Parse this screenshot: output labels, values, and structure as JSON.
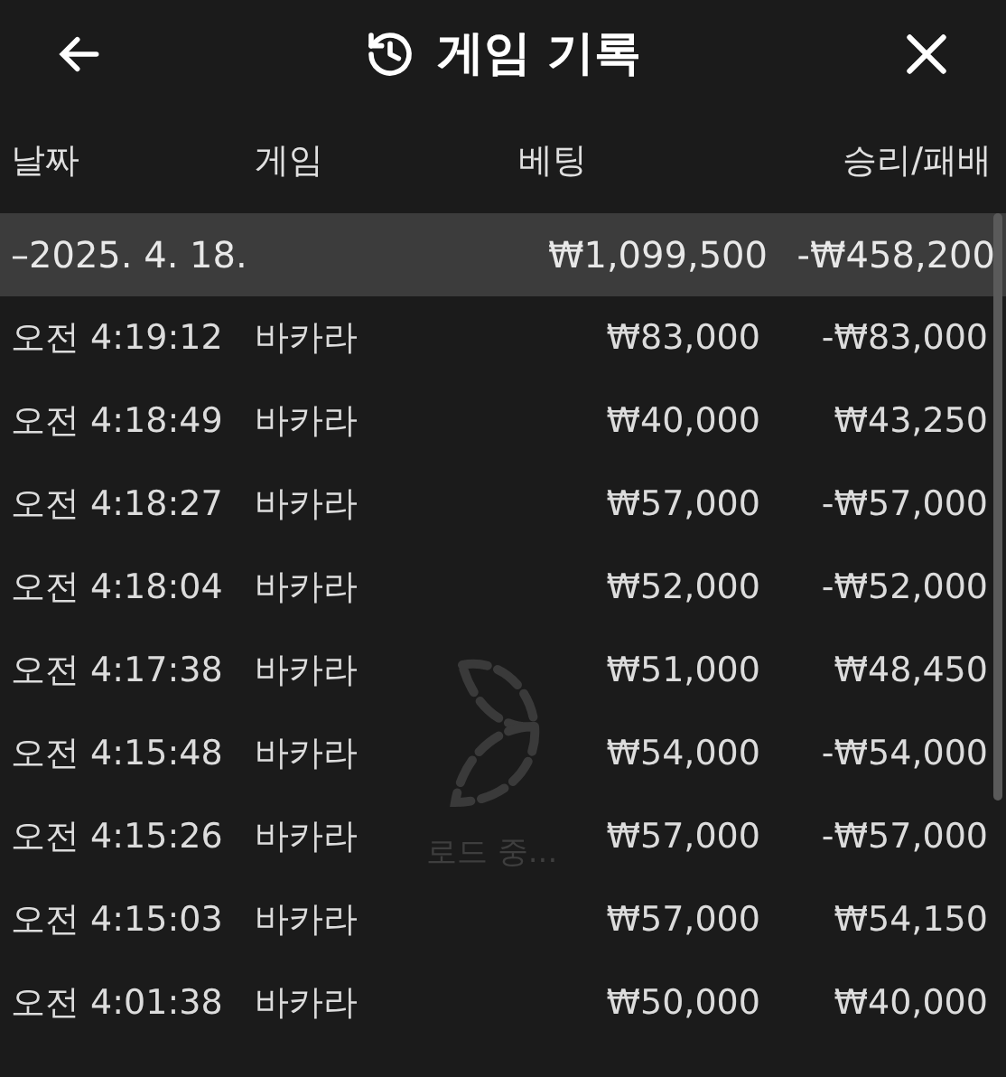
{
  "header": {
    "title": "게임 기록"
  },
  "columns": [
    "날짜",
    "게임",
    "베팅",
    "승리/패배"
  ],
  "group": {
    "toggle": "–",
    "date": "2025. 4. 18.",
    "bet": "₩1,099,500",
    "result": "-₩458,200"
  },
  "rows": [
    {
      "time": "오전 4:19:12",
      "game": "바카라",
      "bet": "₩83,000",
      "result": "-₩83,000"
    },
    {
      "time": "오전 4:18:49",
      "game": "바카라",
      "bet": "₩40,000",
      "result": "₩43,250"
    },
    {
      "time": "오전 4:18:27",
      "game": "바카라",
      "bet": "₩57,000",
      "result": "-₩57,000"
    },
    {
      "time": "오전 4:18:04",
      "game": "바카라",
      "bet": "₩52,000",
      "result": "-₩52,000"
    },
    {
      "time": "오전 4:17:38",
      "game": "바카라",
      "bet": "₩51,000",
      "result": "₩48,450"
    },
    {
      "time": "오전 4:15:48",
      "game": "바카라",
      "bet": "₩54,000",
      "result": "-₩54,000"
    },
    {
      "time": "오전 4:15:26",
      "game": "바카라",
      "bet": "₩57,000",
      "result": "-₩57,000"
    },
    {
      "time": "오전 4:15:03",
      "game": "바카라",
      "bet": "₩57,000",
      "result": "₩54,150"
    },
    {
      "time": "오전 4:01:38",
      "game": "바카라",
      "bet": "₩50,000",
      "result": "₩40,000"
    }
  ],
  "loading": {
    "text": "로드 중..."
  }
}
